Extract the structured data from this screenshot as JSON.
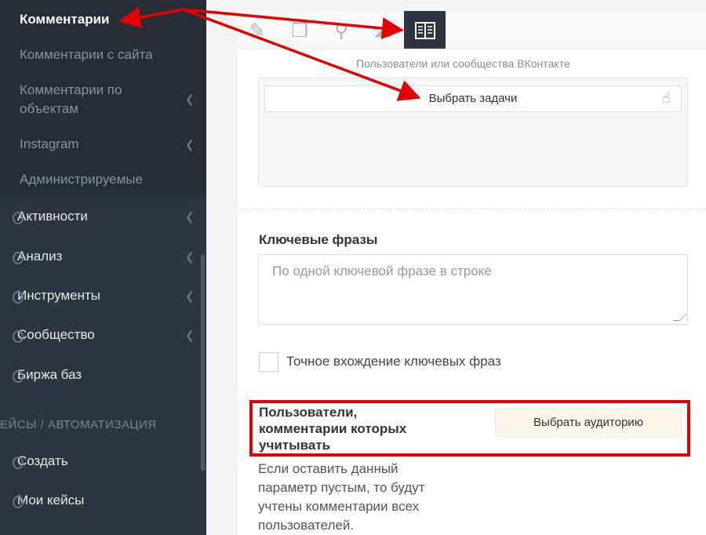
{
  "sidebar": {
    "submenu": [
      {
        "label": "Комментарии",
        "active": true
      },
      {
        "label": "Комментарии с сайта"
      },
      {
        "label": "Комментарии по объектам",
        "line1": "Комментарии по",
        "line2": "объектам"
      },
      {
        "label": "Instagram"
      },
      {
        "label": "Администрируемые"
      }
    ],
    "items": [
      {
        "label": "Активности"
      },
      {
        "label": "Анализ"
      },
      {
        "label": "Инструменты"
      },
      {
        "label": "Сообщество"
      },
      {
        "label": "Биржа баз"
      }
    ],
    "section_title": "ЕЙСЫ / АВТОМАТИЗАЦИЯ",
    "section_items": [
      {
        "label": "Создать"
      },
      {
        "label": "Мои кейсы"
      }
    ]
  },
  "toolbar": {
    "icons": [
      "pencil-icon",
      "copy-icon",
      "location-pin-icon",
      "cloud-icon",
      "book-icon"
    ],
    "active_icon": "book-icon"
  },
  "form": {
    "hint": "Пользователи или сообщества ВКонтакте",
    "task_button": "Выбрать задачи",
    "keywords_label": "Ключевые фразы",
    "keywords_placeholder": "По одной ключевой фразе в строке",
    "exact_match_label": "Точное вхождение ключевых фраз",
    "exact_match_checked": false,
    "audience_title": "Пользователи, комментарии которых учитывать",
    "audience_button": "Выбрать аудиторию",
    "audience_desc": "Если оставить данный параметр пустым, то будут учтены комментарии всех пользователей."
  },
  "colors": {
    "sidebar_bg": "#2f3540",
    "submenu_bg": "#272c36",
    "annotation": "#e30000",
    "audience_btn_bg": "#fdf7ea"
  }
}
